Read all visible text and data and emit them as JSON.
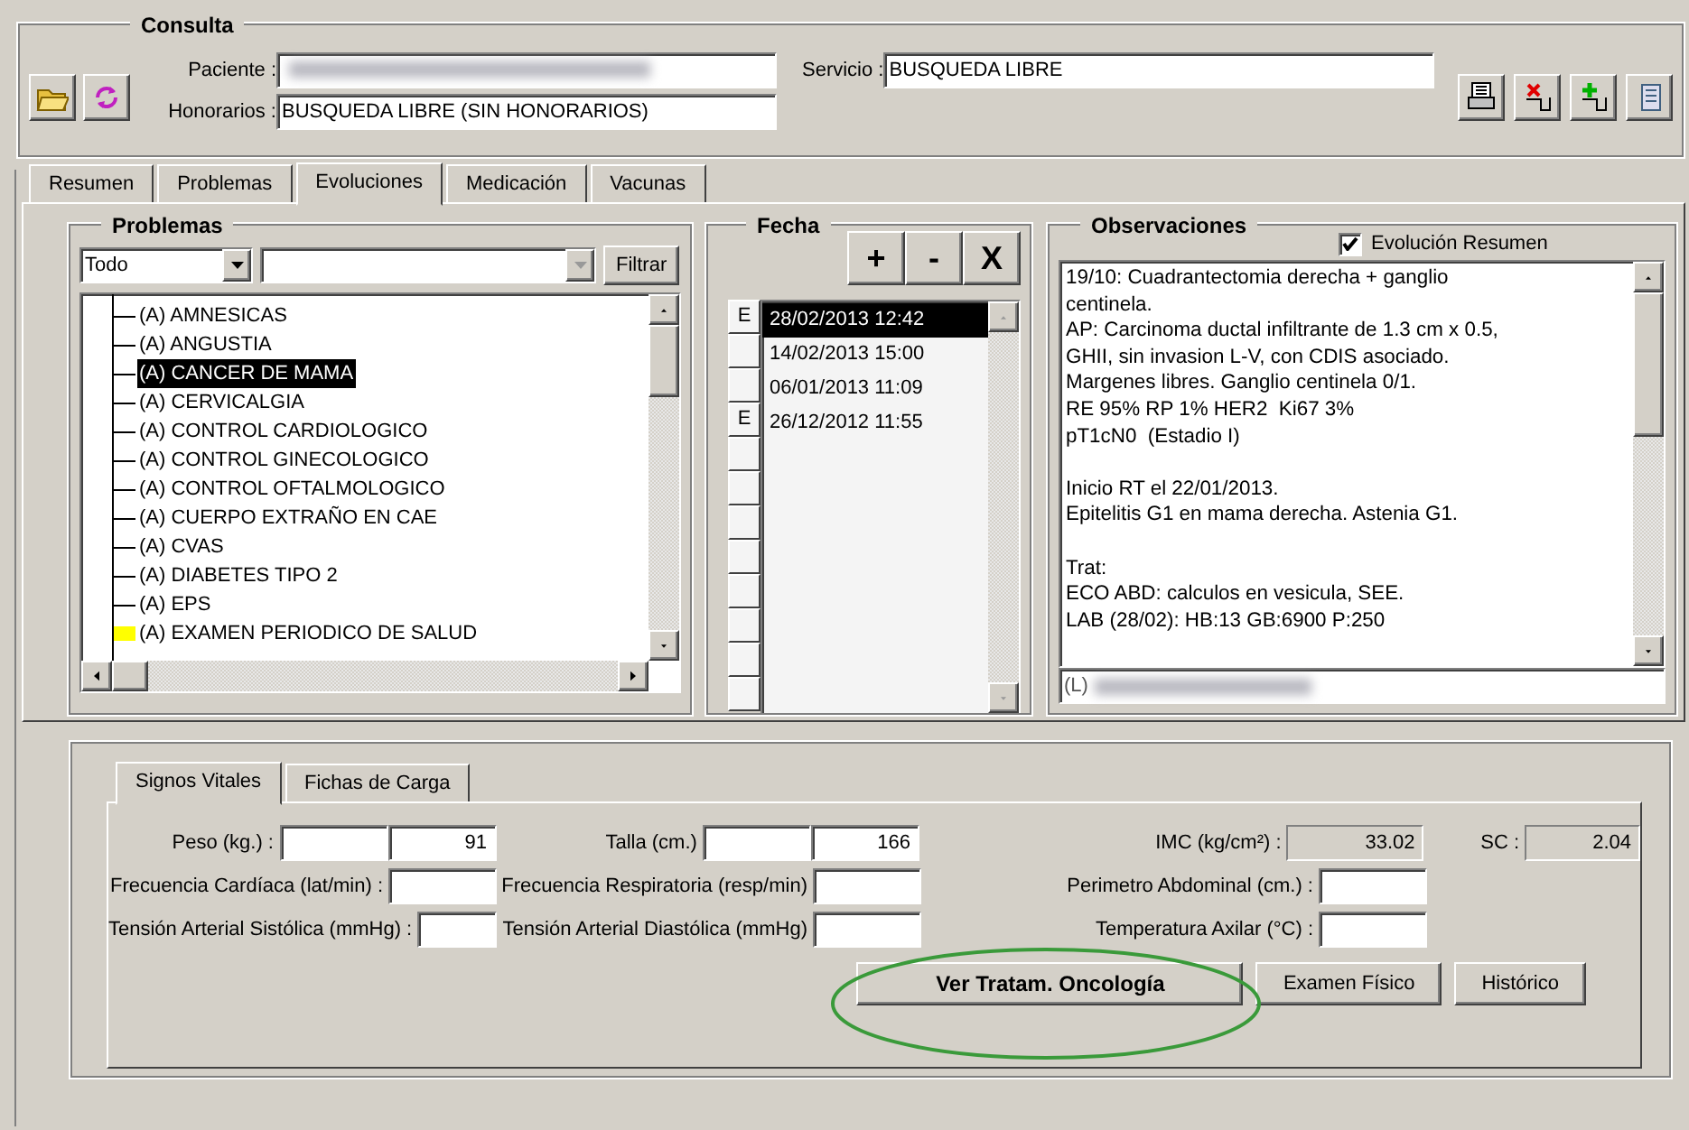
{
  "consulta": {
    "title": "Consulta",
    "fields": [
      {
        "label": "Paciente :",
        "redacted": true
      },
      {
        "label": "Honorarios :",
        "value": "BUSQUEDA LIBRE (SIN HONORARIOS)"
      }
    ],
    "service": {
      "label": "Servicio :",
      "value": "BUSQUEDA LIBRE"
    }
  },
  "tabs": [
    {
      "label": "Resumen",
      "selected": false
    },
    {
      "label": "Problemas",
      "selected": false
    },
    {
      "label": "Evoluciones",
      "selected": true
    },
    {
      "label": "Medicación",
      "selected": false
    },
    {
      "label": "Vacunas",
      "selected": false
    }
  ],
  "problemas": {
    "title": "Problemas",
    "filter_value": "Todo",
    "filter_button": "Filtrar",
    "items": [
      {
        "label": "(A) AMNESICAS",
        "selected": false
      },
      {
        "label": "(A) ANGUSTIA",
        "selected": false
      },
      {
        "label": "(A) CANCER DE MAMA",
        "selected": true
      },
      {
        "label": "(A) CERVICALGIA",
        "selected": false
      },
      {
        "label": "(A) CONTROL CARDIOLOGICO",
        "selected": false
      },
      {
        "label": "(A) CONTROL GINECOLOGICO",
        "selected": false
      },
      {
        "label": "(A) CONTROL OFTALMOLOGICO",
        "selected": false
      },
      {
        "label": "(A) CUERPO EXTRAÑO EN CAE",
        "selected": false
      },
      {
        "label": "(A) CVAS",
        "selected": false
      },
      {
        "label": "(A) DIABETES TIPO 2",
        "selected": false
      },
      {
        "label": "(A) EPS",
        "selected": false
      },
      {
        "label": "(A) EXAMEN PERIODICO DE SALUD",
        "selected": false,
        "color": "#ffff00"
      }
    ]
  },
  "fecha": {
    "title": "Fecha",
    "buttons": [
      "+",
      "-",
      "X"
    ],
    "entries": [
      {
        "date": "28/02/2013 12:42",
        "mark": "E",
        "selected": true
      },
      {
        "date": "14/02/2013 15:00",
        "selected": false
      },
      {
        "date": "06/01/2013 11:09",
        "selected": false
      },
      {
        "date": "26/12/2012 11:55",
        "mark": "E",
        "selected": false
      }
    ]
  },
  "observaciones": {
    "title": "Observaciones",
    "checkbox": {
      "label": "Evolución Resumen",
      "checked": true
    },
    "text": "19/10: Cuadrantectomia derecha + ganglio\ncentinela.\nAP: Carcinoma ductal infiltrante de 1.3 cm x 0.5,\nGHII, sin invasion L-V, con CDIS asociado.\nMargenes libres. Ganglio centinela 0/1.\nRE 95% RP 1% HER2  Ki67 3%\npT1cN0  (Estadio I)\n\nInicio RT el 22/01/2013.\nEpitelitis G1 en mama derecha. Astenia G1.\n\nTrat:\nECO ABD: calculos en vesicula, SEE.\nLAB (28/02): HB:13 GB:6900 P:250",
    "author": {
      "prefix": "(L)",
      "redacted": true
    }
  },
  "vitals_tabs": [
    {
      "label": "Signos Vitales",
      "selected": true
    },
    {
      "label": "Fichas de Carga",
      "selected": false
    }
  ],
  "vitals": [
    [
      {
        "label": "Peso (kg.) :",
        "value": "91",
        "kind": "split"
      },
      {
        "label": "Talla (cm.)",
        "value": "166",
        "kind": "split"
      },
      {
        "label": "IMC (kg/cm²) :",
        "value": "33.02",
        "kind": "readonly"
      },
      {
        "label": "SC :",
        "value": "2.04",
        "kind": "readonly"
      }
    ],
    [
      {
        "label": "Frecuencia Cardíaca (lat/min) :",
        "kind": "input"
      },
      {
        "label": "Frecuencia Respiratoria (resp/min)",
        "kind": "input"
      },
      {
        "label": "Perimetro Abdominal (cm.) :",
        "kind": "input"
      }
    ],
    [
      {
        "label": "Tensión Arterial Sistólica (mmHg) :",
        "kind": "input"
      },
      {
        "label": "Tensión Arterial Diastólica (mmHg)",
        "kind": "input"
      },
      {
        "label": "Temperatura Axilar (°C) :",
        "kind": "input"
      }
    ]
  ],
  "actions": [
    {
      "label": "Ver Tratam. Oncología",
      "bold": true,
      "highlighted": true
    },
    {
      "label": "Examen Físico",
      "bold": false,
      "highlighted": false
    },
    {
      "label": "Histórico",
      "bold": false,
      "highlighted": false
    }
  ]
}
